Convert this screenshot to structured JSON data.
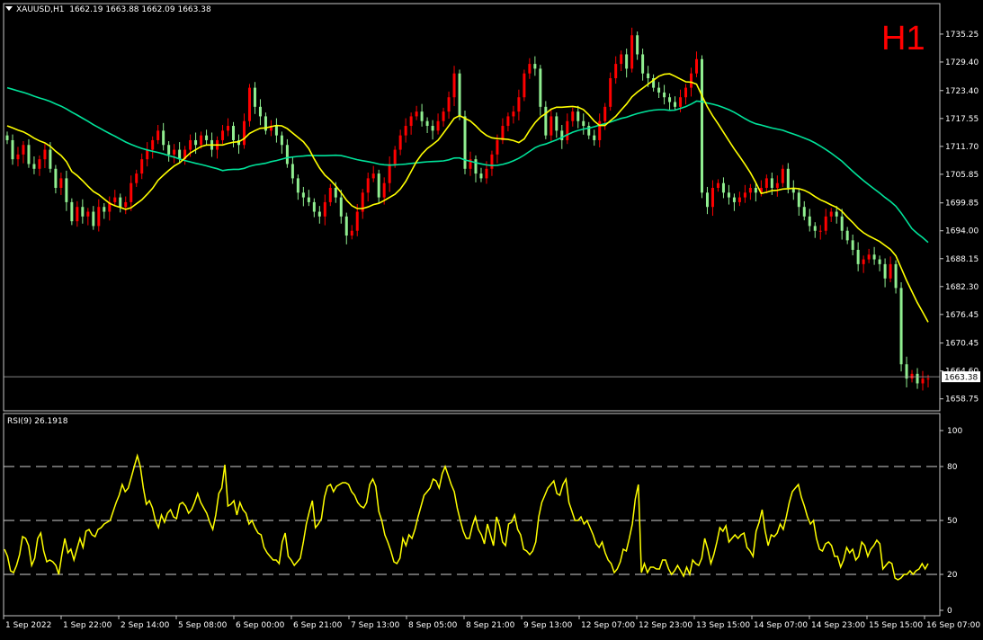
{
  "header": {
    "symbol": "XAUUSD,H1",
    "ohlc": "1662.19 1663.88 1662.09 1663.38",
    "timeframe_label": "H1"
  },
  "rsi_header": "RSI(9) 26.1918",
  "colors": {
    "bull": "#ff0000",
    "bear": "#90ee90",
    "ma_fast": "#ffff00",
    "ma_slow": "#00e39a",
    "rsi": "#ffff00",
    "grid": "#ffffff",
    "background": "#000000"
  },
  "chart_data": [
    {
      "type": "candlestick",
      "title": "XAUUSD,H1",
      "y_ticks": [
        "1735.25",
        "1729.40",
        "1723.40",
        "1717.55",
        "1711.70",
        "1705.85",
        "1699.85",
        "1694.00",
        "1688.15",
        "1682.30",
        "1676.45",
        "1670.45",
        "1664.60",
        "1658.75"
      ],
      "ylim": [
        1657.0,
        1737.5
      ],
      "current_price_label": "1663.38",
      "current_price": 1663.38,
      "x_tick_labels": [
        "1 Sep 2022",
        "1 Sep 22:00",
        "2 Sep 14:00",
        "5 Sep 08:00",
        "6 Sep 00:00",
        "6 Sep 21:00",
        "7 Sep 13:00",
        "8 Sep 05:00",
        "8 Sep 21:00",
        "9 Sep 13:00",
        "12 Sep 07:00",
        "12 Sep 23:00",
        "13 Sep 15:00",
        "14 Sep 07:00",
        "14 Sep 23:00",
        "15 Sep 15:00",
        "16 Sep 07:00"
      ],
      "closes": [
        1713,
        1709,
        1710,
        1712,
        1708,
        1707,
        1709,
        1711,
        1707,
        1703,
        1705,
        1700,
        1696,
        1699,
        1697,
        1698,
        1695,
        1699,
        1698,
        1700,
        1701,
        1699,
        1700,
        1704,
        1706,
        1709,
        1711,
        1713,
        1715,
        1712,
        1710,
        1711,
        1709,
        1711,
        1713,
        1712,
        1714,
        1713,
        1711,
        1713,
        1715,
        1716,
        1713,
        1712,
        1717,
        1724,
        1720,
        1718,
        1715,
        1716,
        1714,
        1712,
        1708,
        1705,
        1702,
        1701,
        1700,
        1698,
        1697,
        1700,
        1703,
        1701,
        1697,
        1693,
        1694,
        1698,
        1702,
        1705,
        1706,
        1701,
        1704,
        1708,
        1711,
        1714,
        1716,
        1718,
        1719,
        1717,
        1716,
        1715,
        1717,
        1719,
        1722,
        1727,
        1718,
        1707,
        1709,
        1706,
        1705,
        1707,
        1710,
        1713,
        1716,
        1718,
        1719,
        1722,
        1727,
        1729,
        1728,
        1720,
        1714,
        1718,
        1715,
        1713,
        1717,
        1719,
        1717,
        1716,
        1714,
        1713,
        1717,
        1720,
        1726,
        1729,
        1731,
        1728,
        1735,
        1731,
        1727,
        1726,
        1724,
        1723,
        1722,
        1721,
        1720,
        1722,
        1724,
        1727,
        1730,
        1702,
        1699,
        1703,
        1704,
        1702,
        1701,
        1700,
        1701,
        1702,
        1703,
        1702,
        1703,
        1705,
        1703,
        1704,
        1707,
        1703,
        1702,
        1699,
        1697,
        1695,
        1694,
        1694,
        1697,
        1698,
        1697,
        1694,
        1692,
        1690,
        1687,
        1688,
        1689,
        1688,
        1687,
        1684,
        1687,
        1682,
        1666,
        1663,
        1664,
        1662,
        1663,
        1663
      ]
    },
    {
      "type": "line",
      "title": "RSI(9) 26.1918",
      "y_ticks": [
        100,
        80,
        50,
        20,
        0
      ],
      "ylim": [
        0,
        100
      ],
      "levels": [
        80,
        50,
        20
      ],
      "values": [
        34,
        30,
        22,
        21,
        25,
        31,
        41,
        40,
        36,
        25,
        29,
        40,
        43,
        33,
        27,
        28,
        27,
        25,
        20,
        31,
        40,
        32,
        34,
        28,
        34,
        40,
        35,
        44,
        45,
        42,
        41,
        45,
        46,
        48,
        49,
        50,
        55,
        60,
        64,
        70,
        66,
        68,
        74,
        80,
        86,
        80,
        68,
        59,
        61,
        57,
        50,
        46,
        53,
        49,
        54,
        56,
        52,
        51,
        59,
        60,
        58,
        54,
        56,
        60,
        65,
        60,
        57,
        54,
        49,
        45,
        53,
        65,
        68,
        81,
        58,
        59,
        61,
        53,
        60,
        56,
        54,
        48,
        50,
        46,
        43,
        42,
        35,
        32,
        30,
        28,
        28,
        26,
        38,
        43,
        30,
        28,
        25,
        27,
        29,
        38,
        48,
        55,
        61,
        46,
        48,
        51,
        63,
        69,
        70,
        66,
        69,
        70,
        71,
        71,
        70,
        66,
        64,
        60,
        58,
        57,
        60,
        70,
        73,
        69,
        55,
        50,
        42,
        38,
        33,
        27,
        26,
        29,
        40,
        36,
        42,
        40,
        45,
        52,
        58,
        64,
        66,
        68,
        73,
        72,
        68,
        76,
        80,
        75,
        70,
        66,
        57,
        50,
        44,
        40,
        40,
        47,
        52,
        45,
        42,
        37,
        48,
        42,
        36,
        52,
        47,
        38,
        36,
        48,
        49,
        53,
        45,
        42,
        34,
        33,
        31,
        33,
        38,
        52,
        60,
        64,
        68,
        70,
        72,
        65,
        64,
        70,
        73,
        60,
        55,
        50,
        50,
        52,
        48,
        50,
        46,
        42,
        37,
        35,
        38,
        32,
        28,
        26,
        21,
        23,
        27,
        34,
        33,
        40,
        48,
        62,
        70,
        21,
        26,
        21,
        24,
        24,
        23,
        23,
        28,
        28,
        23,
        20,
        22,
        25,
        22,
        19,
        24,
        20,
        28,
        26,
        25,
        29,
        40,
        34,
        26,
        31,
        38,
        46,
        44,
        47,
        38,
        40,
        42,
        40,
        42,
        43,
        35,
        33,
        30,
        44,
        49,
        56,
        44,
        36,
        42,
        41,
        43,
        48,
        45,
        52,
        60,
        66,
        68,
        70,
        63,
        58,
        52,
        48,
        50,
        40,
        34,
        33,
        37,
        38,
        36,
        30,
        30,
        24,
        28,
        35,
        32,
        34,
        28,
        30,
        38,
        36,
        30,
        34,
        36,
        39,
        37,
        23,
        25,
        27,
        26,
        18,
        17,
        18,
        20,
        20,
        22,
        20,
        22,
        23,
        26,
        23,
        26
      ]
    }
  ]
}
